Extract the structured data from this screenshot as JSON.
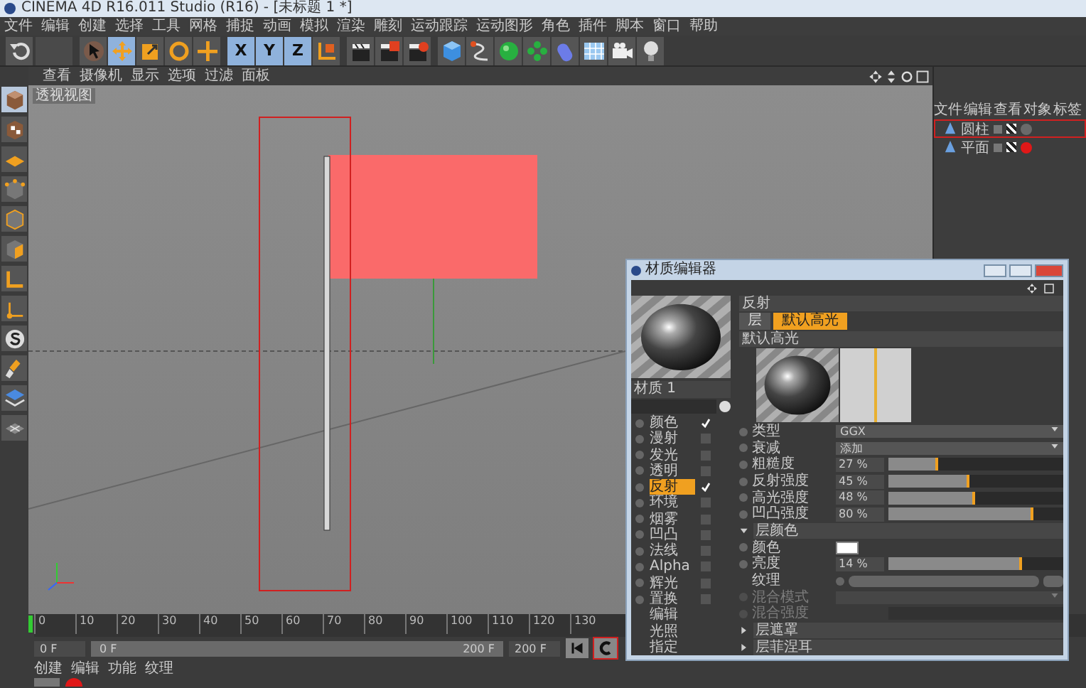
{
  "window": {
    "title": "CINEMA 4D R16.011 Studio (R16) - [未标题 1 *]"
  },
  "menu_bar": [
    "文件",
    "编辑",
    "创建",
    "选择",
    "工具",
    "网格",
    "捕捉",
    "动画",
    "模拟",
    "渲染",
    "雕刻",
    "运动跟踪",
    "运动图形",
    "角色",
    "插件",
    "脚本",
    "窗口",
    "帮助"
  ],
  "toolbar": [
    {
      "kind": "undo",
      "selected": false
    },
    {
      "kind": "select",
      "selected": false
    },
    {
      "kind": "move",
      "selected": true
    },
    {
      "kind": "scale",
      "selected": false
    },
    {
      "kind": "rotate",
      "selected": false
    },
    {
      "kind": "add",
      "selected": false
    },
    {
      "kind": "axis",
      "label": "X",
      "selected": true
    },
    {
      "kind": "axis",
      "label": "Y",
      "selected": true
    },
    {
      "kind": "axis",
      "label": "Z",
      "selected": true
    },
    {
      "kind": "coords",
      "selected": false
    },
    {
      "kind": "render",
      "selected": false
    },
    {
      "kind": "render_view",
      "selected": false
    },
    {
      "kind": "render_settings",
      "selected": false
    },
    {
      "kind": "cube",
      "selected": false
    },
    {
      "kind": "pen",
      "selected": false
    },
    {
      "kind": "nurbs",
      "selected": false
    },
    {
      "kind": "array",
      "selected": false
    },
    {
      "kind": "deformer",
      "selected": false
    },
    {
      "kind": "floor",
      "selected": false
    },
    {
      "kind": "camera",
      "selected": false
    },
    {
      "kind": "light",
      "selected": false
    }
  ],
  "left_toolbar": [
    {
      "kind": "model",
      "selected": true
    },
    {
      "kind": "texture",
      "selected": false
    },
    {
      "kind": "workplane",
      "selected": false
    },
    {
      "kind": "points",
      "selected": false
    },
    {
      "kind": "edges",
      "selected": false
    },
    {
      "kind": "polygons",
      "selected": false
    },
    {
      "kind": "snap",
      "selected": false
    },
    {
      "kind": "axis",
      "selected": false
    },
    {
      "kind": "soft",
      "selected": false
    },
    {
      "kind": "brush",
      "selected": false
    },
    {
      "kind": "layers",
      "selected": false
    },
    {
      "kind": "grid",
      "selected": false
    }
  ],
  "viewport": {
    "menu": [
      "查看",
      "摄像机",
      "显示",
      "选项",
      "过滤",
      "面板"
    ],
    "label": "透视视图"
  },
  "object_manager": {
    "menu": [
      "文件",
      "编辑",
      "查看",
      "对象",
      "标签"
    ],
    "objects": [
      {
        "name": "圆柱",
        "selected": false,
        "color": "#6a6a6a"
      },
      {
        "name": "平面",
        "selected": false,
        "color": "#e01818"
      }
    ]
  },
  "material_editor": {
    "title": "材质编辑器",
    "material_name": "材质 1",
    "channels": [
      {
        "label": "颜色",
        "kind": "toggle",
        "checked": true,
        "selected": false
      },
      {
        "label": "漫射",
        "kind": "toggle",
        "checked": false,
        "selected": false
      },
      {
        "label": "发光",
        "kind": "toggle",
        "checked": false,
        "selected": false
      },
      {
        "label": "透明",
        "kind": "toggle",
        "checked": false,
        "selected": false
      },
      {
        "label": "反射",
        "kind": "toggle",
        "checked": true,
        "selected": true
      },
      {
        "label": "环境",
        "kind": "toggle",
        "checked": false,
        "selected": false
      },
      {
        "label": "烟雾",
        "kind": "toggle",
        "checked": false,
        "selected": false
      },
      {
        "label": "凹凸",
        "kind": "toggle",
        "checked": false,
        "selected": false
      },
      {
        "label": "法线",
        "kind": "toggle",
        "checked": false,
        "selected": false
      },
      {
        "label": "Alpha",
        "kind": "toggle",
        "checked": false,
        "selected": false
      },
      {
        "label": "辉光",
        "kind": "toggle",
        "checked": false,
        "selected": false
      },
      {
        "label": "置换",
        "kind": "toggle",
        "checked": false,
        "selected": false
      },
      {
        "label": "编辑",
        "kind": "page",
        "selected": false
      },
      {
        "label": "光照",
        "kind": "page",
        "selected": false
      },
      {
        "label": "指定",
        "kind": "page",
        "selected": false
      }
    ],
    "section": "反射",
    "layer_tabs": [
      {
        "label": "层",
        "selected": false
      },
      {
        "label": "默认高光",
        "selected": true
      }
    ],
    "layer_title": "默认高光",
    "properties": [
      {
        "kind": "dropdown",
        "label": "类型",
        "value": "GGX",
        "disabled": false
      },
      {
        "kind": "dropdown",
        "label": "衰减",
        "value": "添加",
        "disabled": false
      },
      {
        "kind": "slider",
        "label": "粗糙度",
        "value": "27 %",
        "level": 0.27,
        "disabled": false
      },
      {
        "kind": "slider",
        "label": "反射强度",
        "value": "45 %",
        "level": 0.45,
        "disabled": false
      },
      {
        "kind": "slider",
        "label": "高光强度",
        "value": "48 %",
        "level": 0.48,
        "disabled": false
      },
      {
        "kind": "slider",
        "label": "凹凸强度",
        "value": "80 %",
        "level": 0.81,
        "disabled": false
      },
      {
        "kind": "group",
        "label": "层颜色",
        "expanded": true,
        "disabled": false
      },
      {
        "kind": "color",
        "label": "颜色",
        "color": "#ffffff",
        "disabled": false
      },
      {
        "kind": "slider",
        "label": "亮度",
        "value": "14 %",
        "level": 0.75,
        "disabled": false
      },
      {
        "kind": "texture",
        "label": "纹理",
        "disabled": false
      },
      {
        "kind": "dropdown",
        "label": "混合模式",
        "disabled": true
      },
      {
        "kind": "slider",
        "label": "混合强度",
        "disabled": true
      },
      {
        "kind": "group",
        "label": "层遮罩",
        "expanded": false,
        "disabled": false
      },
      {
        "kind": "group",
        "label": "层菲涅耳",
        "expanded": false,
        "disabled": false
      }
    ]
  },
  "timeline": {
    "ticks": [
      "0",
      "10",
      "20",
      "30",
      "40",
      "50",
      "60",
      "70",
      "80",
      "90",
      "100",
      "110",
      "120",
      "130"
    ],
    "start": "0 F",
    "range_start": "0 F",
    "range_end": "200 F",
    "end": "200 F"
  },
  "material_manager": {
    "menu": [
      "创建",
      "编辑",
      "功能",
      "纹理"
    ]
  }
}
